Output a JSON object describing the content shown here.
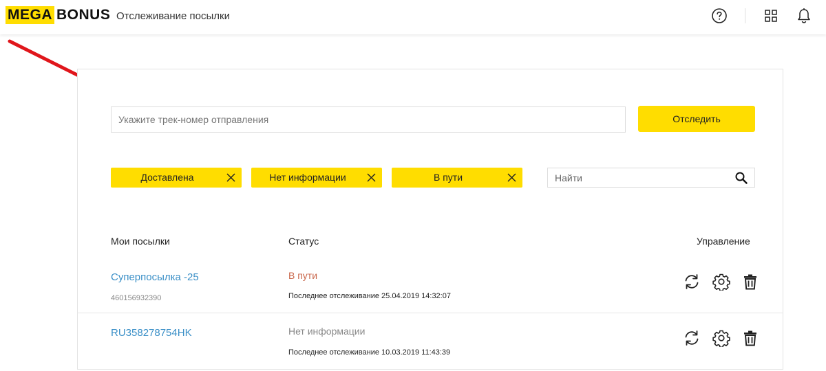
{
  "header": {
    "logo_mega": "MEGA",
    "logo_bonus": "BONUS",
    "page_title": "Отслеживание посылки",
    "icons": [
      "help-icon",
      "apps-grid-icon",
      "bell-icon"
    ]
  },
  "tracking": {
    "placeholder": "Укажите трек-номер отправления",
    "button_label": "Отследить"
  },
  "filters": [
    {
      "label": "Доставлена"
    },
    {
      "label": "Нет информации"
    },
    {
      "label": "В пути"
    }
  ],
  "search": {
    "placeholder": "Найти"
  },
  "table": {
    "headers": {
      "parcels": "Мои посылки",
      "status": "Статус",
      "actions": "Управление"
    },
    "rows": [
      {
        "name": "Суперпосылка -25",
        "number": "460156932390",
        "status": "В пути",
        "last_tracking": "Последнее отслеживание 25.04.2019 14:32:07"
      },
      {
        "name": "RU358278754HK",
        "number": "",
        "status": "Нет информации",
        "last_tracking": "Последнее отслеживание 10.03.2019 11:43:39"
      }
    ]
  },
  "colors": {
    "accent_yellow": "#ffdd00",
    "link_blue": "#3a8fc7",
    "status_in_transit": "#c9664a",
    "status_no_info": "#888888",
    "annotation_arrow": "#e0161b"
  }
}
